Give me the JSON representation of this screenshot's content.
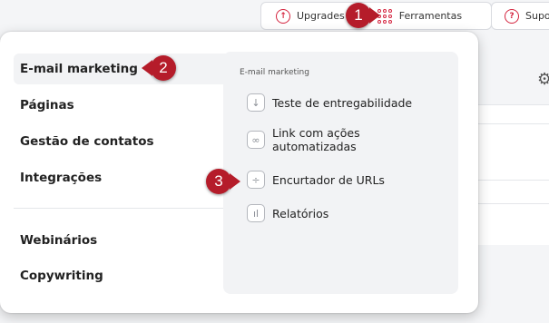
{
  "topbar": {
    "upgrades_label": "Upgrades",
    "ferramentas_label": "Ferramentas",
    "suporte_label": "Supo"
  },
  "menu": {
    "items": [
      {
        "label": "E-mail marketing"
      },
      {
        "label": "Páginas"
      },
      {
        "label": "Gestão de contatos"
      },
      {
        "label": "Integrações"
      },
      {
        "label": "Webinários"
      },
      {
        "label": "Copywriting"
      }
    ],
    "submenu": {
      "title": "E-mail marketing",
      "items": [
        {
          "label": "Teste de entregabilidade",
          "icon": "download-icon"
        },
        {
          "label": "Link com ações automatizadas",
          "icon": "link-icon"
        },
        {
          "label": "Encurtador de URLs",
          "icon": "shorten-icon"
        },
        {
          "label": "Relatórios",
          "icon": "bar-chart-icon"
        }
      ]
    }
  },
  "badges": [
    "1",
    "2",
    "3"
  ],
  "colors": {
    "accent": "#d4243f",
    "badge": "#b51c2a",
    "submenu_bg": "#f2f3f5"
  }
}
